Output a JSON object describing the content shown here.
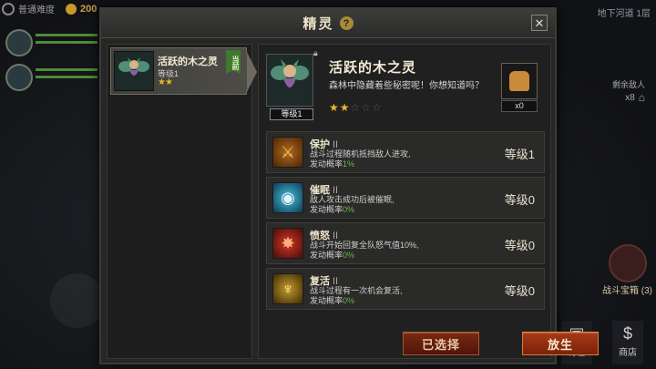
{
  "hud": {
    "difficulty": "普通难度",
    "gold": "200",
    "floor_name": "地下河道 1层",
    "remaining_label": "剩余敌人",
    "remaining_count": "x8",
    "chest_label": "战斗宝箱 (3)",
    "bag_label": "背包",
    "shop_label": "商店"
  },
  "dialog": {
    "title": "精灵",
    "help_glyph": "?",
    "close_glyph": "✕"
  },
  "spirit_list": [
    {
      "name": "活跃的木之灵",
      "level": "等级1",
      "stars": "★★",
      "badge": "当前"
    }
  ],
  "detail": {
    "name": "活跃的木之灵",
    "description": "森林中隐藏着些秘密呢！你想知道吗？",
    "portrait_level": "等级1",
    "stars_filled": 2,
    "stars_total": 5,
    "item_count": "x0",
    "skills": [
      {
        "icon": "protect-icon",
        "title": "保护",
        "rank": "II",
        "line1": "战斗过程随机抵挡敌人进攻,",
        "line2_prefix": "发动概率",
        "pct": "1%",
        "level": "等级1"
      },
      {
        "icon": "eye-icon",
        "title": "催眠",
        "rank": "II",
        "line1": "敌人攻击成功后被催眠,",
        "line2_prefix": "发动概率",
        "pct": "0%",
        "level": "等级0"
      },
      {
        "icon": "rage-icon",
        "title": "愤怒",
        "rank": "II",
        "line1": "战斗开始回复全队怒气值10%,",
        "line2_prefix": "发动概率",
        "pct": "0%",
        "level": "等级0"
      },
      {
        "icon": "revive-icon",
        "title": "复活",
        "rank": "II",
        "line1": "战斗过程有一次机会复活,",
        "line2_prefix": "发动概率",
        "pct": "0%",
        "level": "等级0"
      }
    ]
  },
  "buttons": {
    "selected": "已选择",
    "release": "放生"
  },
  "colors": {
    "accent_gold": "#e8b82a",
    "percent_green": "#6ab84a",
    "button_red": "#a83a1a"
  }
}
